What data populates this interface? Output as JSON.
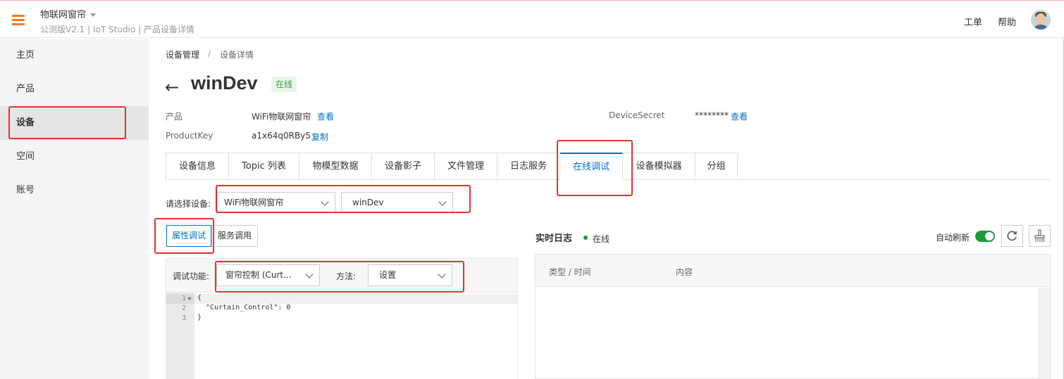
{
  "header": {
    "app_title": "物联网窗帘",
    "app_subtitle": "公测版V2.1 | IoT Studio | 产品设备详情",
    "links": [
      "工单",
      "帮助"
    ]
  },
  "sidebar": {
    "items": [
      {
        "label": "主页"
      },
      {
        "label": "产品"
      },
      {
        "label": "设备",
        "active": true
      },
      {
        "label": "空间"
      },
      {
        "label": "账号"
      }
    ]
  },
  "breadcrumb": {
    "items": [
      "设备管理",
      "设备详情"
    ],
    "separator": "/"
  },
  "device": {
    "name": "winDev",
    "status": "在线",
    "product_label": "产品",
    "product_value": "WiFi物联网窗帘",
    "product_link": "查看",
    "productkey_label": "ProductKey",
    "productkey_value": "a1x64q0RBy5",
    "productkey_link": "复制",
    "secret_label": "DeviceSecret",
    "secret_value": "********",
    "secret_link": "查看"
  },
  "tabs": [
    {
      "label": "设备信息"
    },
    {
      "label": "Topic 列表"
    },
    {
      "label": "物模型数据"
    },
    {
      "label": "设备影子"
    },
    {
      "label": "文件管理"
    },
    {
      "label": "日志服务"
    },
    {
      "label": "在线调试",
      "active": true
    },
    {
      "label": "设备模拟器"
    },
    {
      "label": "分组"
    }
  ],
  "device_select": {
    "label": "请选择设备:",
    "product": "WiFi物联网窗帘",
    "device": "winDev"
  },
  "debug_mode": {
    "options": [
      "属性调试",
      "服务调用"
    ],
    "selected": "属性调试"
  },
  "debug_panel": {
    "function_label": "调试功能:",
    "function_value": "窗帘控制 (Curt...",
    "method_label": "方法:",
    "method_value": "设置",
    "code_lines": [
      "{",
      "  \"Curtain_Control\": 0",
      "}"
    ],
    "line_numbers": [
      "1",
      "2",
      "3"
    ]
  },
  "realtime_log": {
    "title": "实时日志",
    "status": "在线",
    "auto_refresh_label": "自动刷新",
    "auto_refresh_on": true,
    "columns": [
      "类型 / 时间",
      "内容"
    ]
  },
  "colors": {
    "accent": "#0070cc",
    "brand_orange": "#f47a20",
    "online_green": "#1a9a3a",
    "annotation_red": "#e53030"
  }
}
